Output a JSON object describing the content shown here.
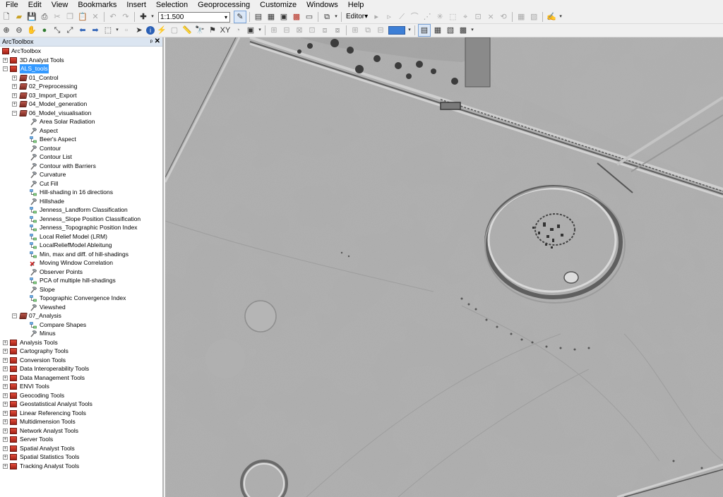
{
  "menu": [
    "File",
    "Edit",
    "View",
    "Bookmarks",
    "Insert",
    "Selection",
    "Geoprocessing",
    "Customize",
    "Windows",
    "Help"
  ],
  "toolbar": {
    "scale": "1:1.500",
    "editor_label": "Editor▾"
  },
  "panel": {
    "title": "ArcToolbox",
    "pin": "ᵖ",
    "close": "✕"
  },
  "tree": [
    {
      "label": "ArcToolbox",
      "level": 0,
      "exp": "",
      "icon": "box"
    },
    {
      "label": "3D Analyst Tools",
      "level": 1,
      "exp": "+",
      "icon": "box"
    },
    {
      "label": "ALS_tools",
      "level": 1,
      "exp": "−",
      "icon": "box",
      "selected": true
    },
    {
      "label": "01_Control",
      "level": 2,
      "exp": "+",
      "icon": "tset"
    },
    {
      "label": "02_Preprocessing",
      "level": 2,
      "exp": "+",
      "icon": "tset"
    },
    {
      "label": "03_Import_Export",
      "level": 2,
      "exp": "+",
      "icon": "tset"
    },
    {
      "label": "04_Model_generation",
      "level": 2,
      "exp": "+",
      "icon": "tset"
    },
    {
      "label": "06_Model_visualisation",
      "level": 2,
      "exp": "−",
      "icon": "tset"
    },
    {
      "label": "Area Solar Radiation",
      "level": 3,
      "icon": "hammer"
    },
    {
      "label": "Aspect",
      "level": 3,
      "icon": "hammer"
    },
    {
      "label": "Beer's Aspect",
      "level": 3,
      "icon": "model"
    },
    {
      "label": "Contour",
      "level": 3,
      "icon": "hammer"
    },
    {
      "label": "Contour List",
      "level": 3,
      "icon": "hammer"
    },
    {
      "label": "Contour with Barriers",
      "level": 3,
      "icon": "hammer"
    },
    {
      "label": "Curvature",
      "level": 3,
      "icon": "hammer"
    },
    {
      "label": "Cut Fill",
      "level": 3,
      "icon": "hammer"
    },
    {
      "label": "Hill-shading in 16 directions",
      "level": 3,
      "icon": "model"
    },
    {
      "label": "Hillshade",
      "level": 3,
      "icon": "hammer"
    },
    {
      "label": "Jenness_Landform Classification",
      "level": 3,
      "icon": "model"
    },
    {
      "label": "Jenness_Slope Position Classification",
      "level": 3,
      "icon": "model"
    },
    {
      "label": "Jenness_Topographic Position Index",
      "level": 3,
      "icon": "model"
    },
    {
      "label": "Local Relief Model (LRM)",
      "level": 3,
      "icon": "model"
    },
    {
      "label": "LocalReliefModel Ableitung",
      "level": 3,
      "icon": "model"
    },
    {
      "label": "Min, max and diff. of hill-shadings",
      "level": 3,
      "icon": "model"
    },
    {
      "label": "Moving Window Correlation",
      "level": 3,
      "icon": "broken"
    },
    {
      "label": "Observer Points",
      "level": 3,
      "icon": "hammer"
    },
    {
      "label": "PCA of multiple hill-shadings",
      "level": 3,
      "icon": "model"
    },
    {
      "label": "Slope",
      "level": 3,
      "icon": "hammer"
    },
    {
      "label": "Topographic Convergence Index",
      "level": 3,
      "icon": "model"
    },
    {
      "label": "Viewshed",
      "level": 3,
      "icon": "hammer"
    },
    {
      "label": "07_Analysis",
      "level": 2,
      "exp": "−",
      "icon": "tset"
    },
    {
      "label": "Compare Shapes",
      "level": 3,
      "icon": "model"
    },
    {
      "label": "Minus",
      "level": 3,
      "icon": "hammer"
    },
    {
      "label": "Analysis Tools",
      "level": 1,
      "exp": "+",
      "icon": "box"
    },
    {
      "label": "Cartography Tools",
      "level": 1,
      "exp": "+",
      "icon": "box"
    },
    {
      "label": "Conversion Tools",
      "level": 1,
      "exp": "+",
      "icon": "box"
    },
    {
      "label": "Data Interoperability Tools",
      "level": 1,
      "exp": "+",
      "icon": "box"
    },
    {
      "label": "Data Management Tools",
      "level": 1,
      "exp": "+",
      "icon": "box"
    },
    {
      "label": "ENVI Tools",
      "level": 1,
      "exp": "+",
      "icon": "box"
    },
    {
      "label": "Geocoding Tools",
      "level": 1,
      "exp": "+",
      "icon": "box"
    },
    {
      "label": "Geostatistical Analyst Tools",
      "level": 1,
      "exp": "+",
      "icon": "box"
    },
    {
      "label": "Linear Referencing Tools",
      "level": 1,
      "exp": "+",
      "icon": "box"
    },
    {
      "label": "Multidimension Tools",
      "level": 1,
      "exp": "+",
      "icon": "box"
    },
    {
      "label": "Network Analyst Tools",
      "level": 1,
      "exp": "+",
      "icon": "box"
    },
    {
      "label": "Server Tools",
      "level": 1,
      "exp": "+",
      "icon": "box"
    },
    {
      "label": "Spatial Analyst Tools",
      "level": 1,
      "exp": "+",
      "icon": "box"
    },
    {
      "label": "Spatial Statistics Tools",
      "level": 1,
      "exp": "+",
      "icon": "box"
    },
    {
      "label": "Tracking Analyst Tools",
      "level": 1,
      "exp": "+",
      "icon": "box"
    }
  ]
}
